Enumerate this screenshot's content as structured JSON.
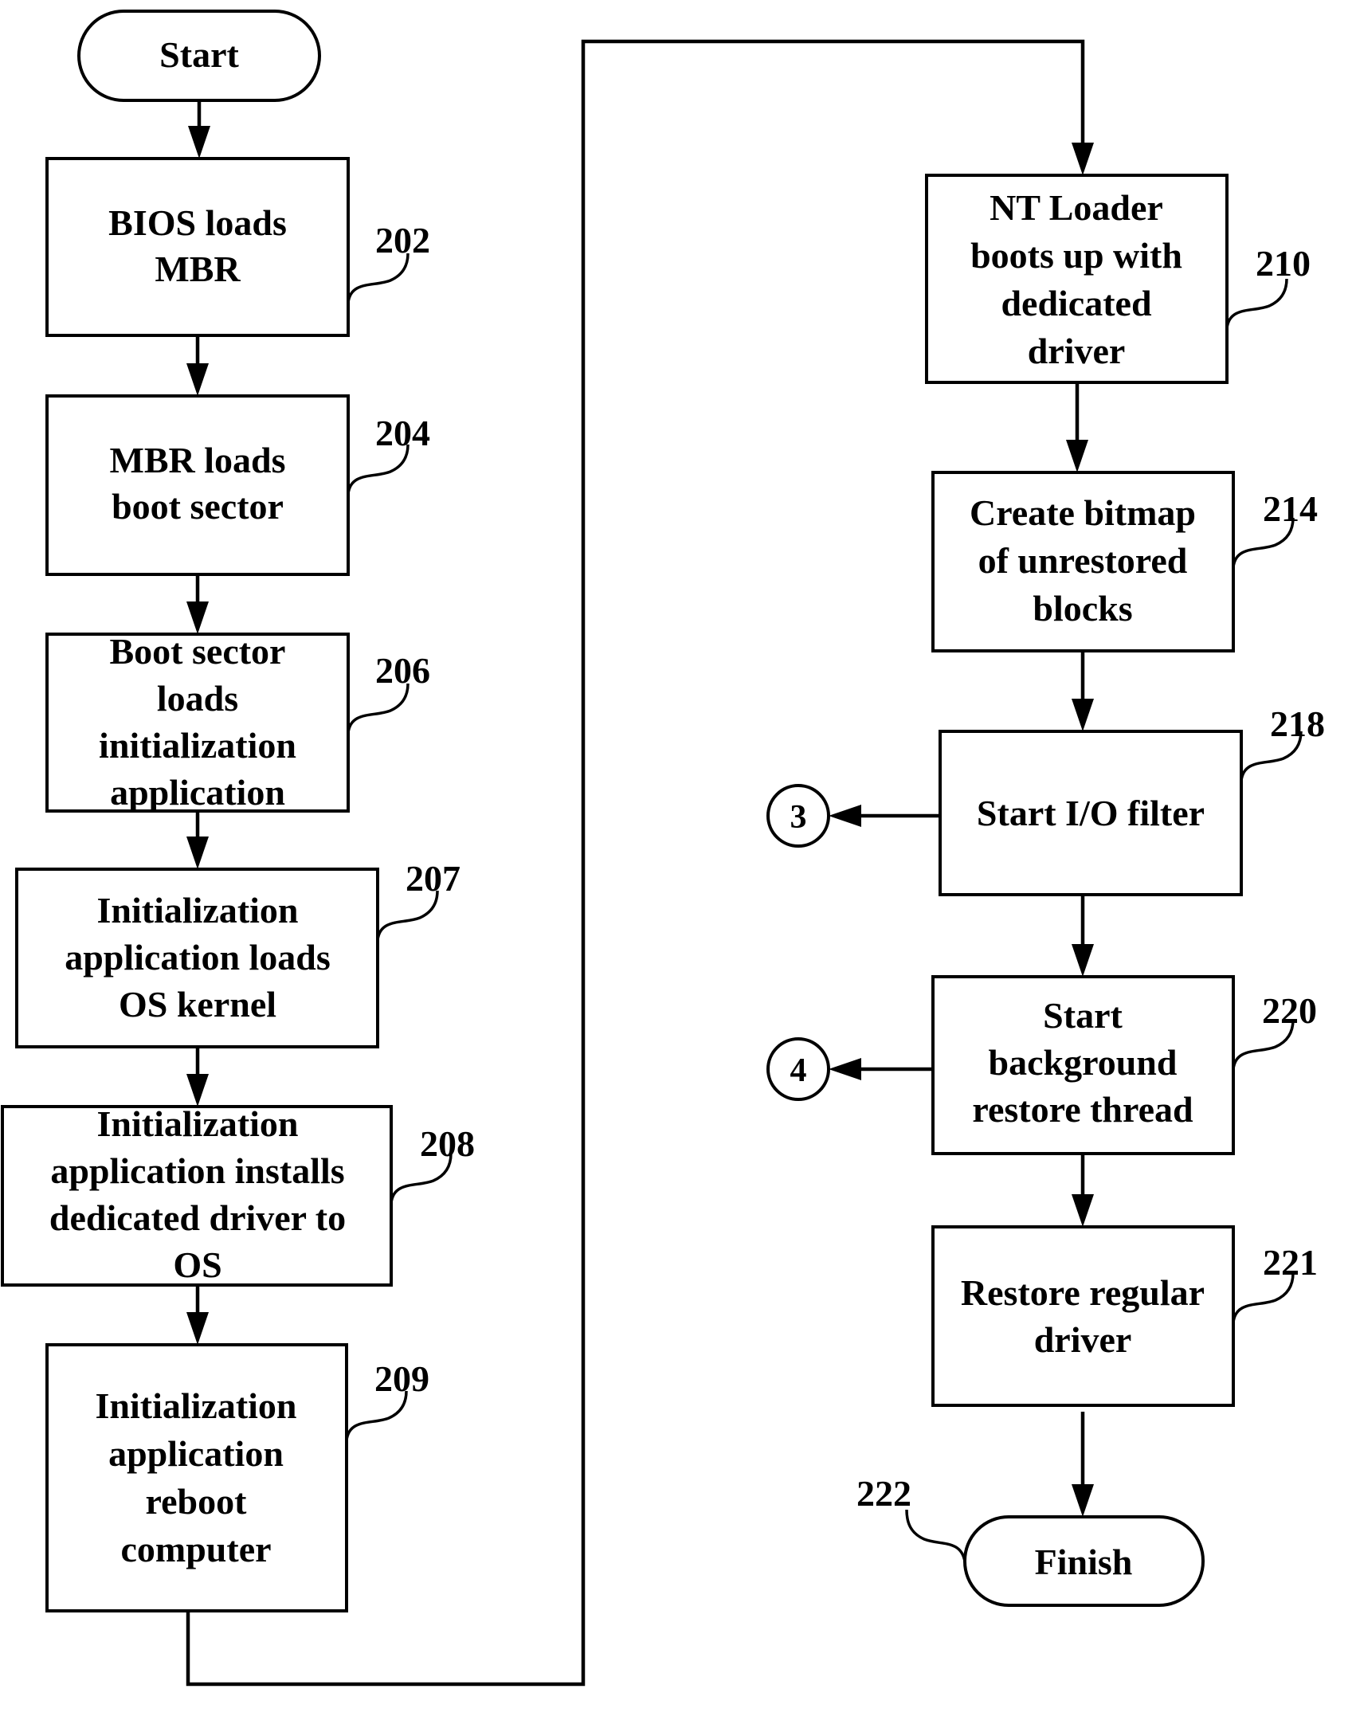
{
  "diagram": {
    "type": "flowchart",
    "terminals": {
      "start": {
        "label": "Start"
      },
      "finish": {
        "label": "Finish",
        "ref": "222"
      }
    },
    "steps": [
      {
        "id": "202",
        "ref": "202",
        "lines": [
          "BIOS loads",
          "MBR"
        ]
      },
      {
        "id": "204",
        "ref": "204",
        "lines": [
          "MBR loads",
          "boot sector"
        ]
      },
      {
        "id": "206",
        "ref": "206",
        "lines": [
          "Boot sector",
          "loads",
          "initialization",
          "application"
        ]
      },
      {
        "id": "207",
        "ref": "207",
        "lines": [
          "Initialization",
          "application loads",
          "OS kernel"
        ]
      },
      {
        "id": "208",
        "ref": "208",
        "lines": [
          "Initialization",
          "application  installs",
          "dedicated driver to",
          "OS"
        ]
      },
      {
        "id": "209",
        "ref": "209",
        "lines": [
          "Initialization",
          "application",
          "reboot",
          "computer"
        ]
      },
      {
        "id": "210",
        "ref": "210",
        "lines": [
          "NT Loader",
          "boots up with",
          "dedicated",
          "driver"
        ]
      },
      {
        "id": "214",
        "ref": "214",
        "lines": [
          "Create bitmap",
          "of unrestored",
          "blocks"
        ]
      },
      {
        "id": "218",
        "ref": "218",
        "lines": [
          "Start I/O filter"
        ]
      },
      {
        "id": "220",
        "ref": "220",
        "lines": [
          "Start",
          "background",
          "restore thread"
        ]
      },
      {
        "id": "221",
        "ref": "221",
        "lines": [
          "Restore regular",
          "driver"
        ]
      }
    ],
    "connectors": [
      {
        "label": "3",
        "from": "218"
      },
      {
        "label": "4",
        "from": "220"
      }
    ],
    "flow": [
      "start",
      "202",
      "204",
      "206",
      "207",
      "208",
      "209",
      "210",
      "214",
      "218",
      "220",
      "221",
      "finish"
    ]
  }
}
